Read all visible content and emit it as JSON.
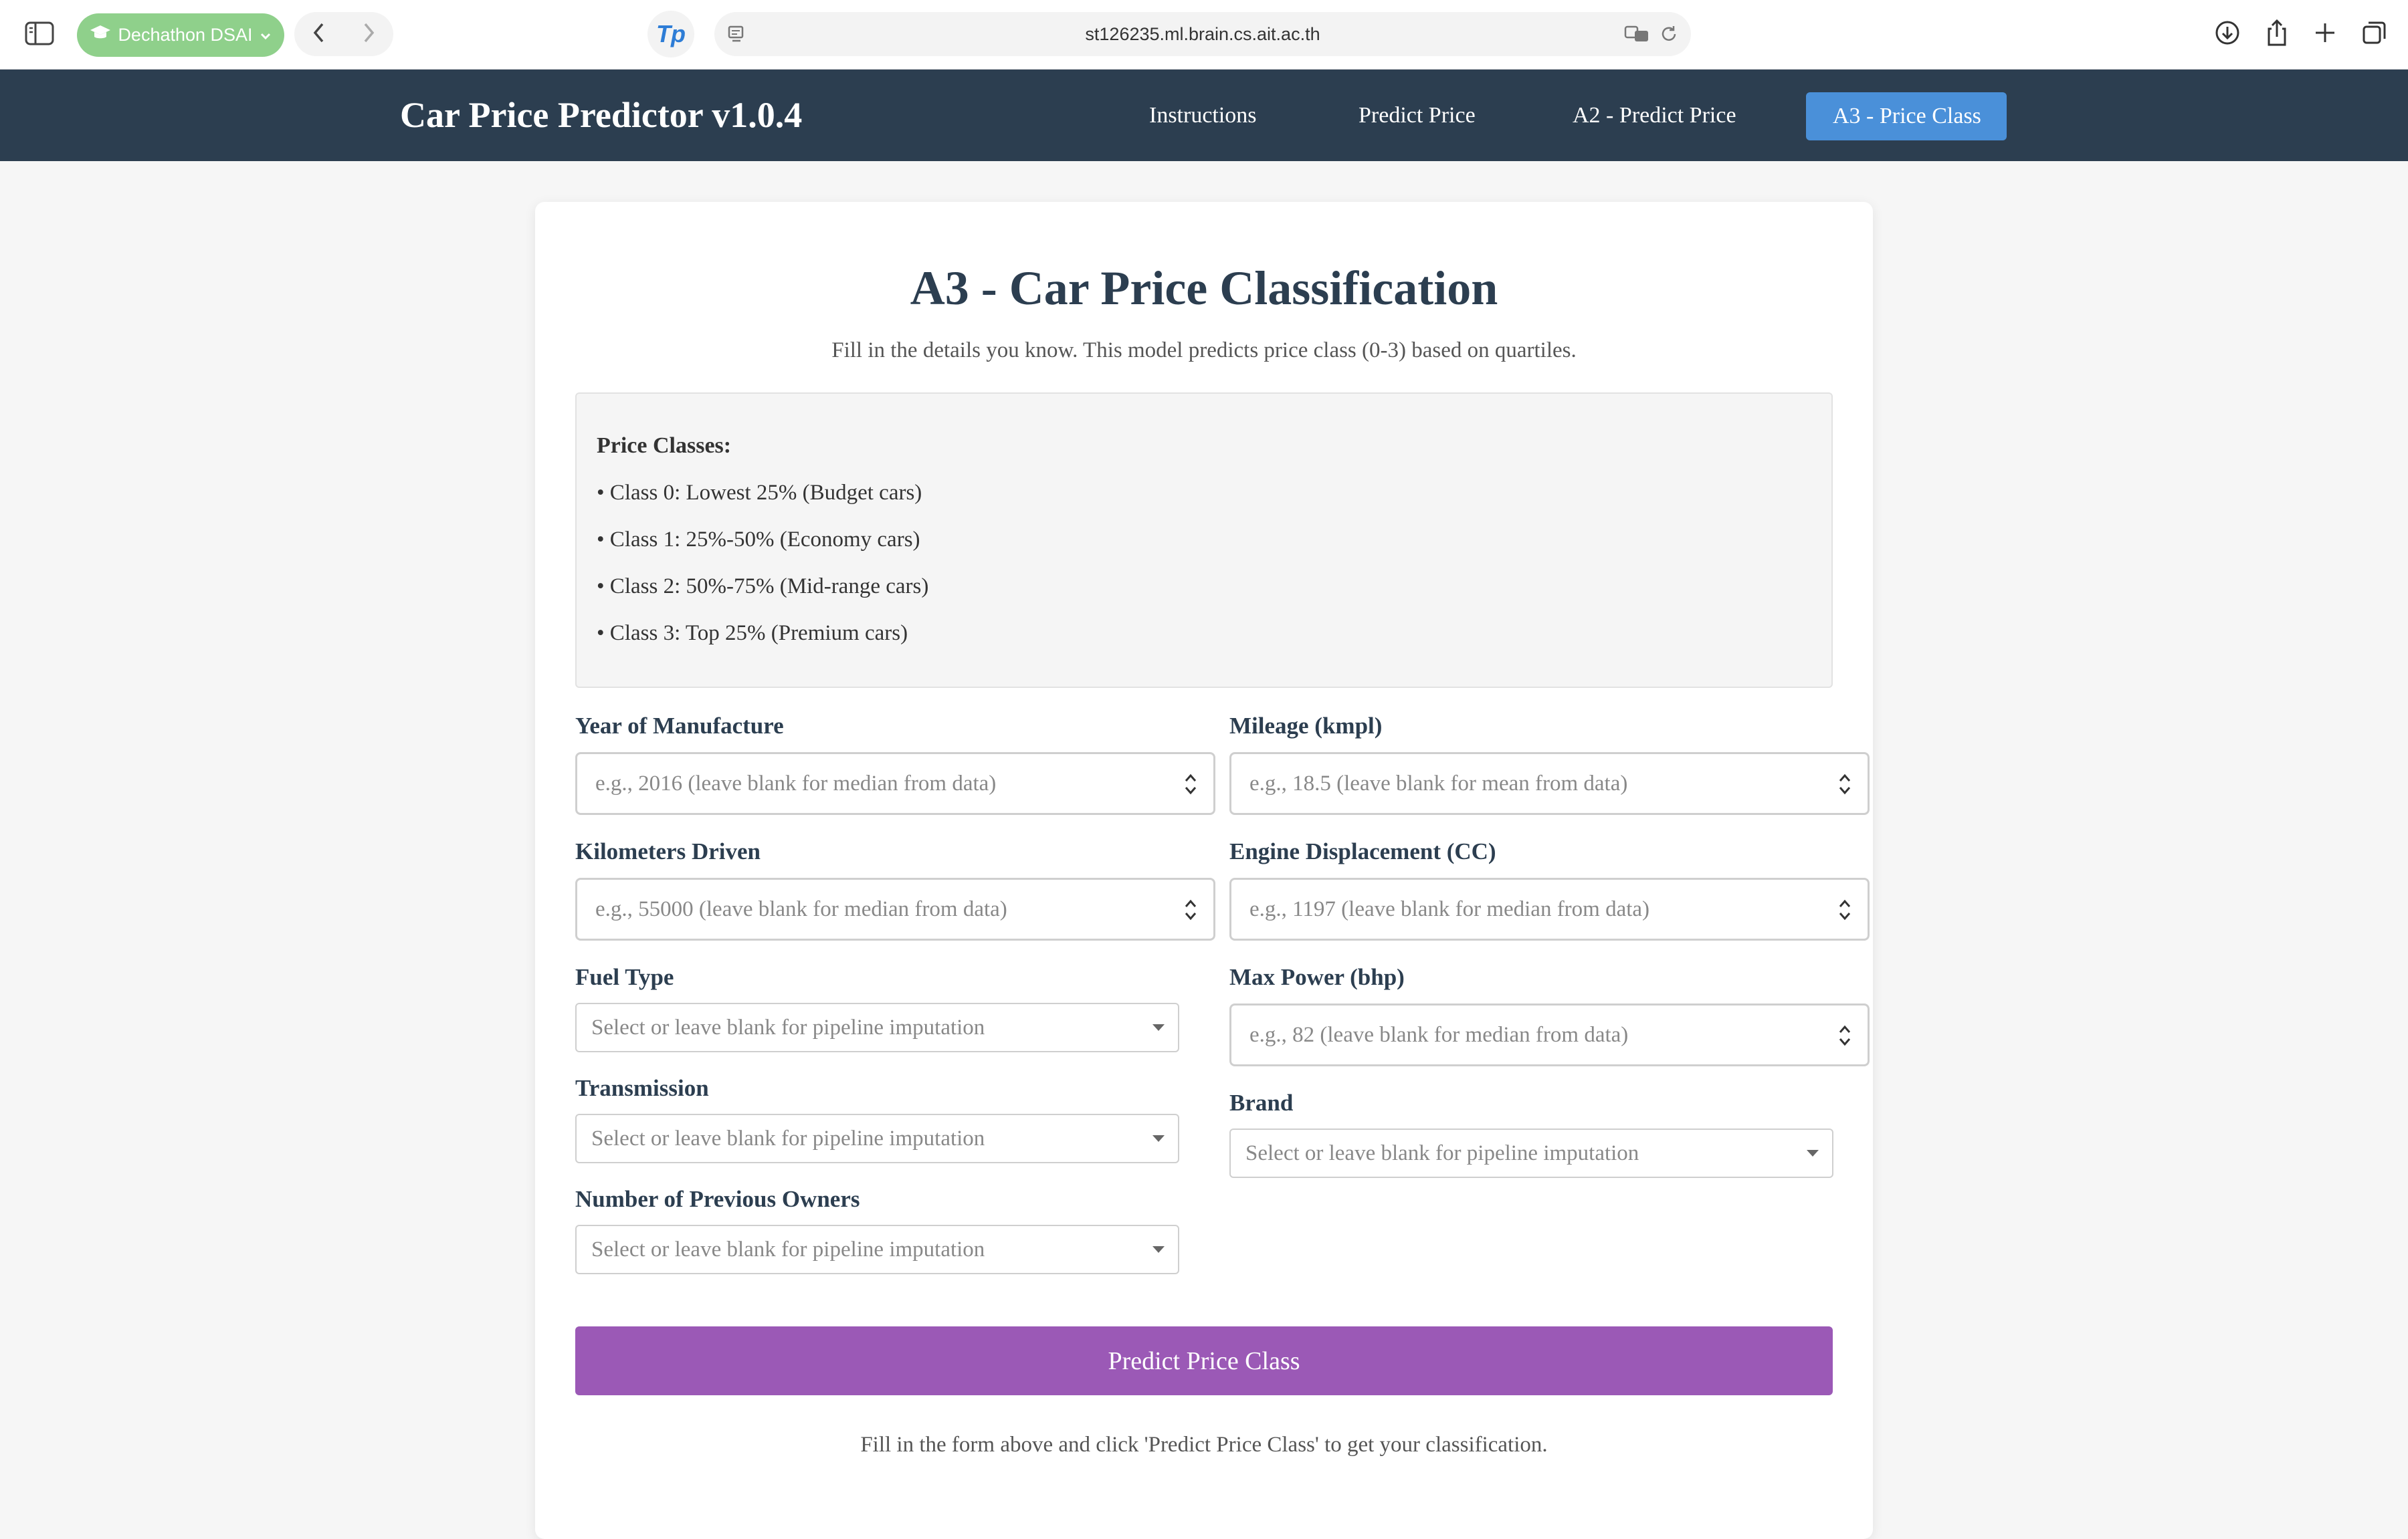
{
  "browser": {
    "profile_label": "Dechathon DSAI",
    "url": "st126235.ml.brain.cs.ait.ac.th",
    "extension_label": "Tp"
  },
  "navbar": {
    "brand": "Car Price Predictor v1.0.4",
    "links": [
      "Instructions",
      "Predict Price",
      "A2 - Predict Price",
      "A3 - Price Class"
    ],
    "active_link": "A3 - Price Class"
  },
  "page": {
    "title": "A3 - Car Price Classification",
    "subtitle": "Fill in the details you know. This model predicts price class (0-3) based on quartiles."
  },
  "price_classes": {
    "heading": "Price Classes:",
    "items": [
      "• Class 0: Lowest 25% (Budget cars)",
      "• Class 1: 25%-50% (Economy cars)",
      "• Class 2: 50%-75% (Mid-range cars)",
      "• Class 3: Top 25% (Premium cars)"
    ]
  },
  "form": {
    "year": {
      "label": "Year of Manufacture",
      "placeholder": "e.g., 2016 (leave blank for median from data)"
    },
    "km": {
      "label": "Kilometers Driven",
      "placeholder": "e.g., 55000 (leave blank for median from data)"
    },
    "fuel": {
      "label": "Fuel Type",
      "placeholder": "Select or leave blank for pipeline imputation"
    },
    "transmission": {
      "label": "Transmission",
      "placeholder": "Select or leave blank for pipeline imputation"
    },
    "owners": {
      "label": "Number of Previous Owners",
      "placeholder": "Select or leave blank for pipeline imputation"
    },
    "mileage": {
      "label": "Mileage (kmpl)",
      "placeholder": "e.g., 18.5 (leave blank for mean from data)"
    },
    "engine": {
      "label": "Engine Displacement (CC)",
      "placeholder": "e.g., 1197 (leave blank for median from data)"
    },
    "power": {
      "label": "Max Power (bhp)",
      "placeholder": "e.g., 82 (leave blank for median from data)"
    },
    "brand": {
      "label": "Brand",
      "placeholder": "Select or leave blank for pipeline imputation"
    },
    "submit_label": "Predict Price Class"
  },
  "result_hint": "Fill in the form above and click 'Predict Price Class' to get your classification.",
  "colors": {
    "navbar": "#2c3e50",
    "active_tab": "#4a90d9",
    "submit_button": "#9b59b6",
    "profile_pill": "#8fd08b"
  }
}
